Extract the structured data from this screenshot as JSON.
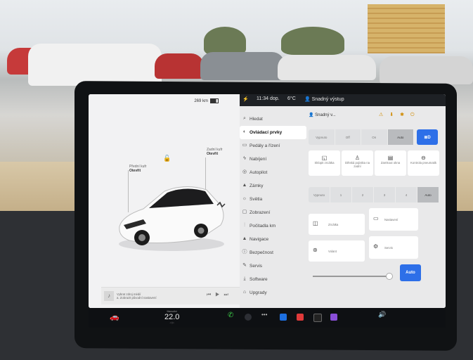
{
  "car_panel": {
    "range": "269 km",
    "trunk_front_label": "Přední kufr",
    "trunk_front_state": "Otevřít",
    "trunk_rear_label": "Zadní kufr",
    "trunk_rear_state": "Otevřít",
    "media_line1": "Vybrat zdroj médií",
    "media_line2": "a. Zobrazit původní nastavení"
  },
  "status_bar": {
    "time": "11:34 dop.",
    "temperature": "6°C",
    "profile": "Snadný výstup"
  },
  "menu": {
    "search": "Hledat",
    "items": [
      {
        "label": "Ovládací prvky",
        "icon": "toggle-icon"
      },
      {
        "label": "Pedály a řízení",
        "icon": "car-icon"
      },
      {
        "label": "Nabíjení",
        "icon": "bolt-icon"
      },
      {
        "label": "Autopilot",
        "icon": "steering-icon"
      },
      {
        "label": "Zámky",
        "icon": "lock-icon"
      },
      {
        "label": "Světla",
        "icon": "light-icon"
      },
      {
        "label": "Zobrazení",
        "icon": "display-icon"
      },
      {
        "label": "Počitadla km",
        "icon": "odometer-icon"
      },
      {
        "label": "Navigace",
        "icon": "navigation-icon"
      },
      {
        "label": "Bezpečnost",
        "icon": "shield-icon"
      },
      {
        "label": "Servis",
        "icon": "wrench-icon"
      },
      {
        "label": "Software",
        "icon": "download-icon"
      },
      {
        "label": "Upgrady",
        "icon": "bag-icon"
      }
    ]
  },
  "controls": {
    "profile_name": "Snadný v...",
    "lights_segments": [
      "Vypnuto",
      "Off",
      "On",
      "Auto"
    ],
    "tiles_row": [
      "Sklopit zrcátka",
      "Dětská pojistka na zadní",
      "Zamkout okna",
      "Kontrola pneumatik"
    ],
    "wiper_segments": [
      "Vypnuto",
      "1",
      "2",
      "3",
      "4",
      "Auto"
    ],
    "mirrors_label": "Zrcátka",
    "steering_label": "Volant",
    "brightness_auto": "Auto",
    "tile_right1": "Nastavení",
    "tile_right2": "Servis"
  },
  "taskbar": {
    "temp_label": "Manuální",
    "temperature": "22.0",
    "temp_sub": "◁ ▷"
  }
}
